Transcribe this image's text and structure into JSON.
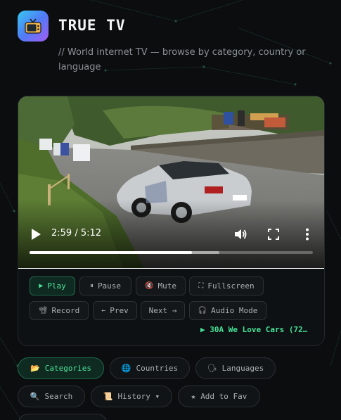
{
  "header": {
    "title": "TRUE TV",
    "subtitle": "// World internet TV — browse by category, country or language",
    "logo_icon": "tv-icon"
  },
  "player": {
    "time": "2:59 / 5:12",
    "progress": 0.574,
    "buffered": 0.67,
    "now_playing": "▶ 30A We Love Cars (72…"
  },
  "controls": [
    {
      "id": "play",
      "label": "Play",
      "icon": "▶",
      "active": true
    },
    {
      "id": "pause",
      "label": "Pause",
      "icon": "⏸",
      "active": false
    },
    {
      "id": "mute",
      "label": "Mute",
      "icon": "🔇",
      "active": false
    },
    {
      "id": "fullscreen",
      "label": "Fullscreen",
      "icon": "⛶",
      "active": false
    },
    {
      "id": "record",
      "label": "Record",
      "icon": "📽",
      "active": false
    },
    {
      "id": "prev",
      "label": "Prev",
      "icon": "←",
      "active": false
    },
    {
      "id": "next",
      "label": "Next →",
      "icon": "",
      "active": false
    },
    {
      "id": "audio",
      "label": "Audio Mode",
      "icon": "🎧",
      "active": false
    }
  ],
  "nav": [
    {
      "id": "categories",
      "label": "Categories",
      "icon": "📂",
      "active": true
    },
    {
      "id": "countries",
      "label": "Countries",
      "icon": "🌐",
      "active": false
    },
    {
      "id": "languages",
      "label": "Languages",
      "icon": "🗣",
      "active": false
    },
    {
      "id": "search",
      "label": "Search",
      "icon": "🔍",
      "active": false
    },
    {
      "id": "history",
      "label": "History ▾",
      "icon": "📜",
      "active": false
    },
    {
      "id": "fav",
      "label": "Add to Fav",
      "icon": "★",
      "active": false
    }
  ],
  "colors": {
    "accent": "#4ee39b",
    "background": "#0b0d0f"
  }
}
